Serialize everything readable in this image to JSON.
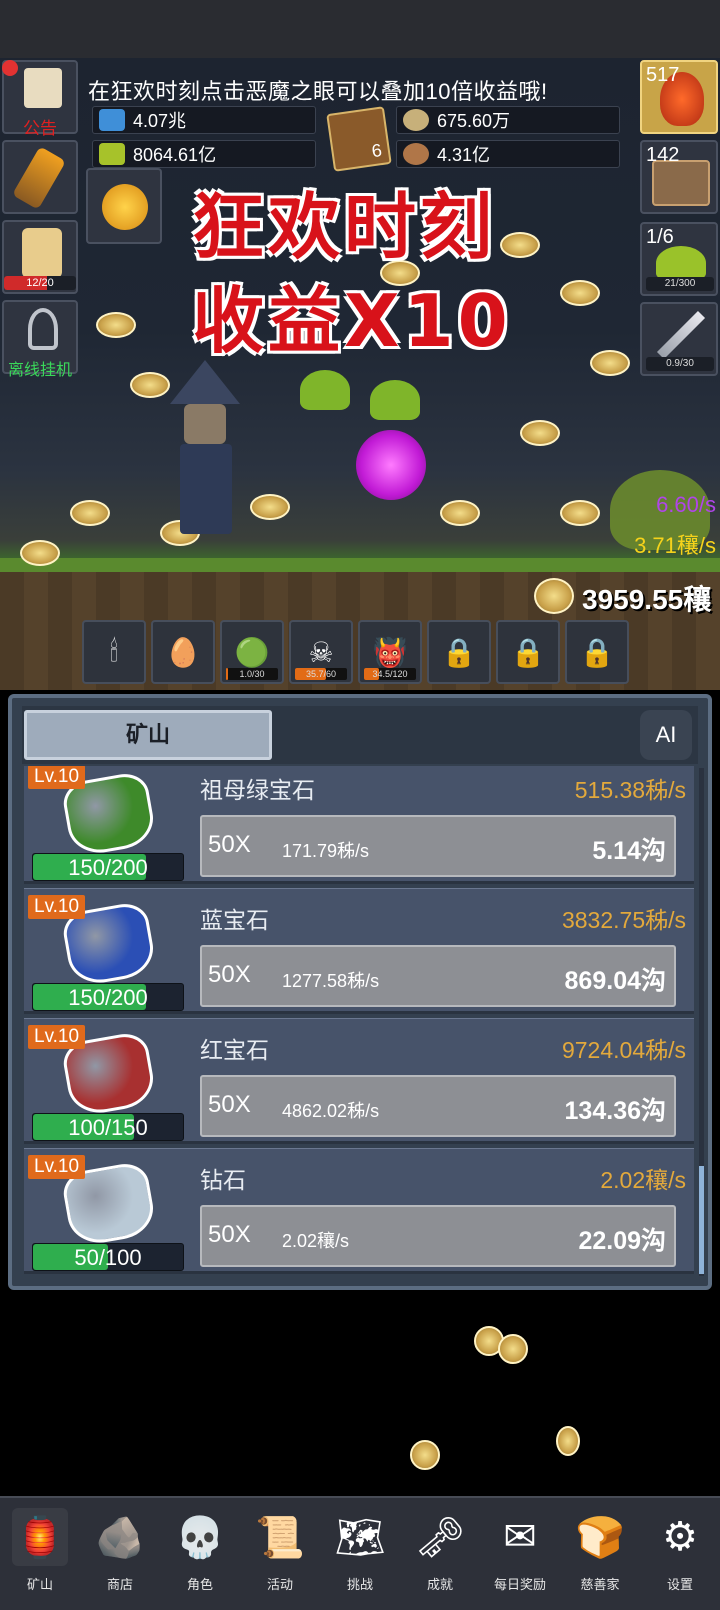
{
  "notice": "在狂欢时刻点击恶魔之眼可以叠加10倍收益哦!",
  "resources": {
    "blue_potion": "4.07兆",
    "gold_coins": "675.60万",
    "green_potion": "8064.61亿",
    "meat": "4.31亿",
    "book_count": "6"
  },
  "left_buttons": {
    "announcement": "公告",
    "beer_bar": "12/20",
    "offline": "离线挂机"
  },
  "right_buttons": {
    "potion_count": "517",
    "chest_count": "142",
    "slime_count": "1/6",
    "slime_bar": "21/300",
    "sword_bar": "0.9/30"
  },
  "banner": {
    "line1": "狂欢时刻",
    "line2": "收益X10"
  },
  "rates": {
    "purple": "6.60/s",
    "yellow": "3.71穰/s",
    "total": "3959.55穰"
  },
  "slots": [
    {
      "icon": "candle-icon",
      "glyph": "🕯",
      "bar": null,
      "fill": 0
    },
    {
      "icon": "egg-icon",
      "glyph": "🥚",
      "bar": null,
      "fill": 0
    },
    {
      "icon": "slime-icon",
      "glyph": "🟢",
      "bar": "1.0/30",
      "fill": 0.03
    },
    {
      "icon": "zombie-icon",
      "glyph": "☠",
      "bar": "35.7/60",
      "fill": 0.6
    },
    {
      "icon": "demon-icon",
      "glyph": "👹",
      "bar": "34.5/120",
      "fill": 0.29
    },
    {
      "icon": "lock-icon",
      "glyph": "🔒",
      "bar": null,
      "fill": 0
    },
    {
      "icon": "lock-icon",
      "glyph": "🔒",
      "bar": null,
      "fill": 0
    },
    {
      "icon": "lock-icon",
      "glyph": "🔒",
      "bar": null,
      "fill": 0
    }
  ],
  "panel": {
    "tab": "矿山",
    "ai": "AI"
  },
  "gems": [
    {
      "lv": "Lv.10",
      "name": "祖母绿宝石",
      "rate": "515.38秭/s",
      "progress": "150/200",
      "fill": 0.75,
      "mult": "50X",
      "inc": "171.79秭/s",
      "cost": "5.14沟",
      "color": "#3e8a2a"
    },
    {
      "lv": "Lv.10",
      "name": "蓝宝石",
      "rate": "3832.75秭/s",
      "progress": "150/200",
      "fill": 0.75,
      "mult": "50X",
      "inc": "1277.58秭/s",
      "cost": "869.04沟",
      "color": "#2b4fb5"
    },
    {
      "lv": "Lv.10",
      "name": "红宝石",
      "rate": "9724.04秭/s",
      "progress": "100/150",
      "fill": 0.67,
      "mult": "50X",
      "inc": "4862.02秭/s",
      "cost": "134.36沟",
      "color": "#a83030"
    },
    {
      "lv": "Lv.10",
      "name": "钻石",
      "rate": "2.02穰/s",
      "progress": "50/100",
      "fill": 0.5,
      "mult": "50X",
      "inc": "2.02穰/s",
      "cost": "22.09沟",
      "color": "#b9c9d6"
    }
  ],
  "nav": [
    {
      "label": "矿山",
      "icon": "lantern-icon",
      "glyph": "🏮"
    },
    {
      "label": "商店",
      "icon": "rock-icon",
      "glyph": "🪨"
    },
    {
      "label": "角色",
      "icon": "skull-icon",
      "glyph": "💀"
    },
    {
      "label": "活动",
      "icon": "scroll-icon",
      "glyph": "📜"
    },
    {
      "label": "挑战",
      "icon": "map-icon",
      "glyph": "🗺"
    },
    {
      "label": "成就",
      "icon": "key-icon",
      "glyph": "🗝"
    },
    {
      "label": "每日奖励",
      "icon": "envelope-icon",
      "glyph": "✉"
    },
    {
      "label": "慈善家",
      "icon": "bread-icon",
      "glyph": "🍞"
    },
    {
      "label": "设置",
      "icon": "gear-icon",
      "glyph": "⚙"
    }
  ]
}
